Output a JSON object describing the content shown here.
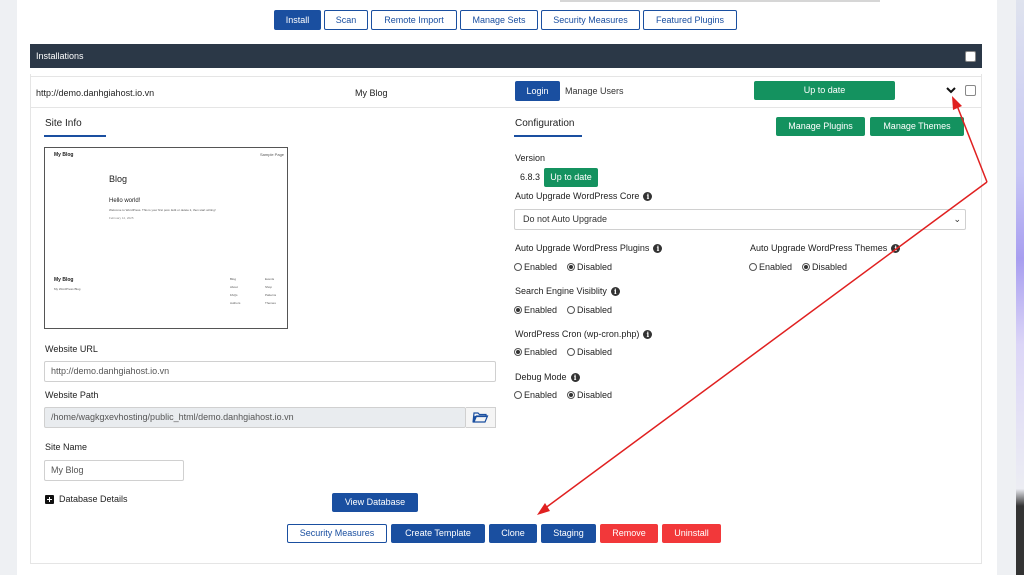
{
  "tabs": [
    {
      "label": "Install",
      "active": true
    },
    {
      "label": "Scan"
    },
    {
      "label": "Remote Import"
    },
    {
      "label": "Manage Sets"
    },
    {
      "label": "Security Measures"
    },
    {
      "label": "Featured Plugins"
    }
  ],
  "installations": {
    "title": "Installations",
    "row": {
      "url": "http://demo.danhgiahost.io.vn",
      "name": "My Blog",
      "login_label": "Login",
      "manage_users_label": "Manage Users",
      "status_label": "Up to date"
    }
  },
  "site_info": {
    "title": "Site Info",
    "preview": {
      "site_title": "My Blog",
      "menu_link": "Sample Page",
      "heading": "Blog",
      "post_title": "Hello world!",
      "post_excerpt": "Welcome to WordPress. This is your first post. Edit or delete it, then start writing!",
      "post_date": "February 12, 2025",
      "footer_title": "My Blog",
      "footer_tagline": "My WordPress Blog",
      "footer_col1": [
        "Blog",
        "About",
        "FAQs",
        "Authors"
      ],
      "footer_col2": [
        "Events",
        "Shop",
        "Patterns",
        "Themes"
      ]
    },
    "website_url_label": "Website URL",
    "website_url_value": "http://demo.danhgiahost.io.vn",
    "website_path_label": "Website Path",
    "website_path_value": "/home/wagkgxevhosting/public_html/demo.danhgiahost.io.vn",
    "site_name_label": "Site Name",
    "site_name_value": "My Blog",
    "database_details_label": "Database Details",
    "view_database_label": "View Database"
  },
  "configuration": {
    "title": "Configuration",
    "manage_plugins_label": "Manage Plugins",
    "manage_themes_label": "Manage Themes",
    "version_label": "Version",
    "version_value": "6.8.3",
    "version_status": "Up to date",
    "auto_upgrade_core_label": "Auto Upgrade WordPress Core",
    "auto_upgrade_core_value": "Do not Auto Upgrade",
    "auto_upgrade_plugins_label": "Auto Upgrade WordPress Plugins",
    "auto_upgrade_themes_label": "Auto Upgrade WordPress Themes",
    "search_visibility_label": "Search Engine Visiblity",
    "cron_label": "WordPress Cron (wp-cron.php)",
    "debug_label": "Debug Mode",
    "enabled_label": "Enabled",
    "disabled_label": "Disabled",
    "states": {
      "plugins": "Disabled",
      "themes": "Disabled",
      "search": "Enabled",
      "cron": "Enabled",
      "debug": "Disabled"
    }
  },
  "actions": {
    "security_measures": "Security Measures",
    "create_template": "Create Template",
    "clone": "Clone",
    "staging": "Staging",
    "remove": "Remove",
    "uninstall": "Uninstall"
  },
  "colors": {
    "primary": "#1a4fa0",
    "success": "#14925f",
    "danger": "#f2383a",
    "header_bar": "#2b3847",
    "annotation": "#e02020"
  },
  "icons": {
    "expand": "chevron-down-icon",
    "folder": "folder-open-icon",
    "info": "info-icon",
    "expand_db": "plus-square-icon"
  }
}
